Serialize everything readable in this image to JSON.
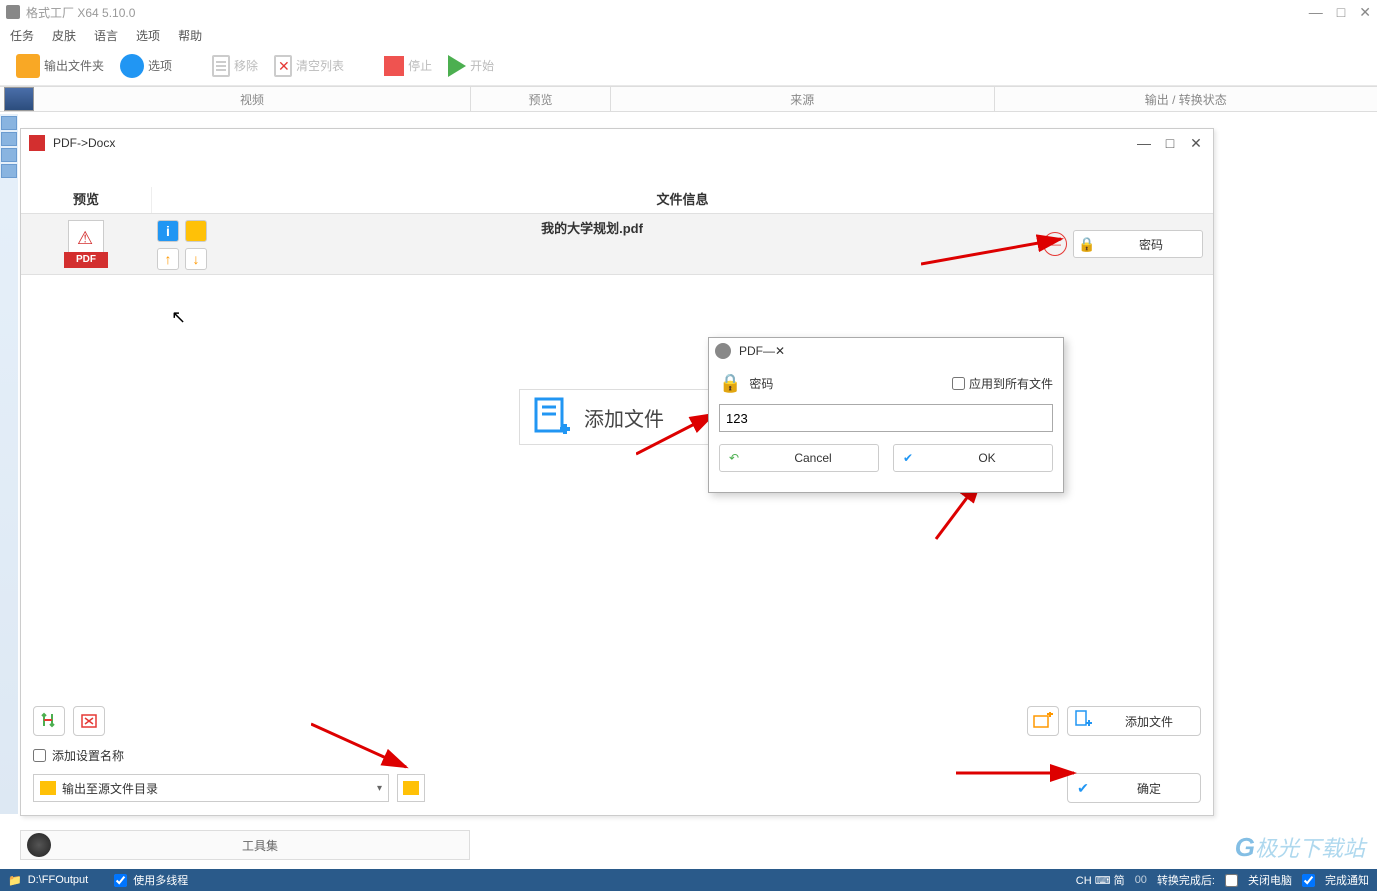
{
  "app": {
    "title": "格式工厂 X64 5.10.0"
  },
  "menu": [
    "任务",
    "皮肤",
    "语言",
    "选项",
    "帮助"
  ],
  "toolbar": {
    "output_folder": "输出文件夹",
    "options": "选项",
    "remove": "移除",
    "clear": "清空列表",
    "stop": "停止",
    "start": "开始"
  },
  "columns": {
    "video": "视频",
    "preview": "预览",
    "source": "来源",
    "status": "输出 / 转换状态"
  },
  "subwin": {
    "title": "PDF->Docx",
    "headers": {
      "preview": "预览",
      "fileinfo": "文件信息"
    },
    "file": {
      "name": "我的大学规划.pdf",
      "badge": "PDF"
    },
    "password_btn": "密码",
    "add_file_big": "添加文件",
    "add_file_btn": "添加文件",
    "ok_btn": "确定",
    "add_settings_name": "添加设置名称",
    "output_dir": "输出至源文件目录"
  },
  "dialog": {
    "title": "PDF",
    "label": "密码",
    "apply_all": "应用到所有文件",
    "value": "123",
    "cancel": "Cancel",
    "ok": "OK"
  },
  "toolset": "工具集",
  "status": {
    "path": "D:\\FFOutput",
    "multithread": "使用多线程",
    "after": "转换完成后:",
    "shutdown": "关闭电脑",
    "notify": "完成通知",
    "ime": "CH ⌨ 简"
  },
  "watermark": "极光下载站"
}
